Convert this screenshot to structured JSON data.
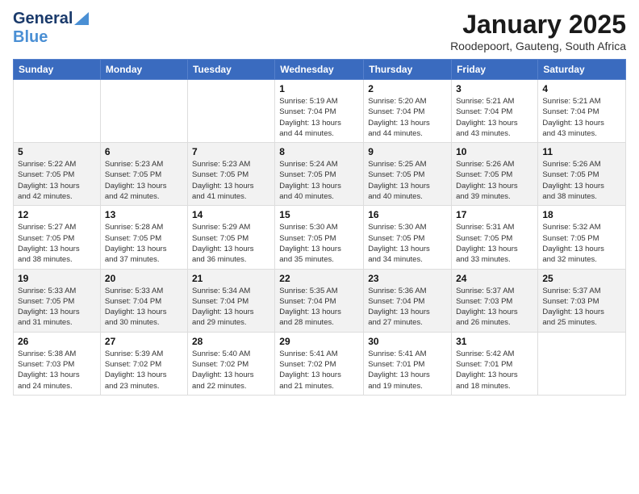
{
  "header": {
    "logo_general": "General",
    "logo_blue": "Blue",
    "month_title": "January 2025",
    "subtitle": "Roodepoort, Gauteng, South Africa"
  },
  "days_of_week": [
    "Sunday",
    "Monday",
    "Tuesday",
    "Wednesday",
    "Thursday",
    "Friday",
    "Saturday"
  ],
  "weeks": [
    [
      {
        "day": "",
        "info": ""
      },
      {
        "day": "",
        "info": ""
      },
      {
        "day": "",
        "info": ""
      },
      {
        "day": "1",
        "info": "Sunrise: 5:19 AM\nSunset: 7:04 PM\nDaylight: 13 hours\nand 44 minutes."
      },
      {
        "day": "2",
        "info": "Sunrise: 5:20 AM\nSunset: 7:04 PM\nDaylight: 13 hours\nand 44 minutes."
      },
      {
        "day": "3",
        "info": "Sunrise: 5:21 AM\nSunset: 7:04 PM\nDaylight: 13 hours\nand 43 minutes."
      },
      {
        "day": "4",
        "info": "Sunrise: 5:21 AM\nSunset: 7:04 PM\nDaylight: 13 hours\nand 43 minutes."
      }
    ],
    [
      {
        "day": "5",
        "info": "Sunrise: 5:22 AM\nSunset: 7:05 PM\nDaylight: 13 hours\nand 42 minutes."
      },
      {
        "day": "6",
        "info": "Sunrise: 5:23 AM\nSunset: 7:05 PM\nDaylight: 13 hours\nand 42 minutes."
      },
      {
        "day": "7",
        "info": "Sunrise: 5:23 AM\nSunset: 7:05 PM\nDaylight: 13 hours\nand 41 minutes."
      },
      {
        "day": "8",
        "info": "Sunrise: 5:24 AM\nSunset: 7:05 PM\nDaylight: 13 hours\nand 40 minutes."
      },
      {
        "day": "9",
        "info": "Sunrise: 5:25 AM\nSunset: 7:05 PM\nDaylight: 13 hours\nand 40 minutes."
      },
      {
        "day": "10",
        "info": "Sunrise: 5:26 AM\nSunset: 7:05 PM\nDaylight: 13 hours\nand 39 minutes."
      },
      {
        "day": "11",
        "info": "Sunrise: 5:26 AM\nSunset: 7:05 PM\nDaylight: 13 hours\nand 38 minutes."
      }
    ],
    [
      {
        "day": "12",
        "info": "Sunrise: 5:27 AM\nSunset: 7:05 PM\nDaylight: 13 hours\nand 38 minutes."
      },
      {
        "day": "13",
        "info": "Sunrise: 5:28 AM\nSunset: 7:05 PM\nDaylight: 13 hours\nand 37 minutes."
      },
      {
        "day": "14",
        "info": "Sunrise: 5:29 AM\nSunset: 7:05 PM\nDaylight: 13 hours\nand 36 minutes."
      },
      {
        "day": "15",
        "info": "Sunrise: 5:30 AM\nSunset: 7:05 PM\nDaylight: 13 hours\nand 35 minutes."
      },
      {
        "day": "16",
        "info": "Sunrise: 5:30 AM\nSunset: 7:05 PM\nDaylight: 13 hours\nand 34 minutes."
      },
      {
        "day": "17",
        "info": "Sunrise: 5:31 AM\nSunset: 7:05 PM\nDaylight: 13 hours\nand 33 minutes."
      },
      {
        "day": "18",
        "info": "Sunrise: 5:32 AM\nSunset: 7:05 PM\nDaylight: 13 hours\nand 32 minutes."
      }
    ],
    [
      {
        "day": "19",
        "info": "Sunrise: 5:33 AM\nSunset: 7:05 PM\nDaylight: 13 hours\nand 31 minutes."
      },
      {
        "day": "20",
        "info": "Sunrise: 5:33 AM\nSunset: 7:04 PM\nDaylight: 13 hours\nand 30 minutes."
      },
      {
        "day": "21",
        "info": "Sunrise: 5:34 AM\nSunset: 7:04 PM\nDaylight: 13 hours\nand 29 minutes."
      },
      {
        "day": "22",
        "info": "Sunrise: 5:35 AM\nSunset: 7:04 PM\nDaylight: 13 hours\nand 28 minutes."
      },
      {
        "day": "23",
        "info": "Sunrise: 5:36 AM\nSunset: 7:04 PM\nDaylight: 13 hours\nand 27 minutes."
      },
      {
        "day": "24",
        "info": "Sunrise: 5:37 AM\nSunset: 7:03 PM\nDaylight: 13 hours\nand 26 minutes."
      },
      {
        "day": "25",
        "info": "Sunrise: 5:37 AM\nSunset: 7:03 PM\nDaylight: 13 hours\nand 25 minutes."
      }
    ],
    [
      {
        "day": "26",
        "info": "Sunrise: 5:38 AM\nSunset: 7:03 PM\nDaylight: 13 hours\nand 24 minutes."
      },
      {
        "day": "27",
        "info": "Sunrise: 5:39 AM\nSunset: 7:02 PM\nDaylight: 13 hours\nand 23 minutes."
      },
      {
        "day": "28",
        "info": "Sunrise: 5:40 AM\nSunset: 7:02 PM\nDaylight: 13 hours\nand 22 minutes."
      },
      {
        "day": "29",
        "info": "Sunrise: 5:41 AM\nSunset: 7:02 PM\nDaylight: 13 hours\nand 21 minutes."
      },
      {
        "day": "30",
        "info": "Sunrise: 5:41 AM\nSunset: 7:01 PM\nDaylight: 13 hours\nand 19 minutes."
      },
      {
        "day": "31",
        "info": "Sunrise: 5:42 AM\nSunset: 7:01 PM\nDaylight: 13 hours\nand 18 minutes."
      },
      {
        "day": "",
        "info": ""
      }
    ]
  ]
}
